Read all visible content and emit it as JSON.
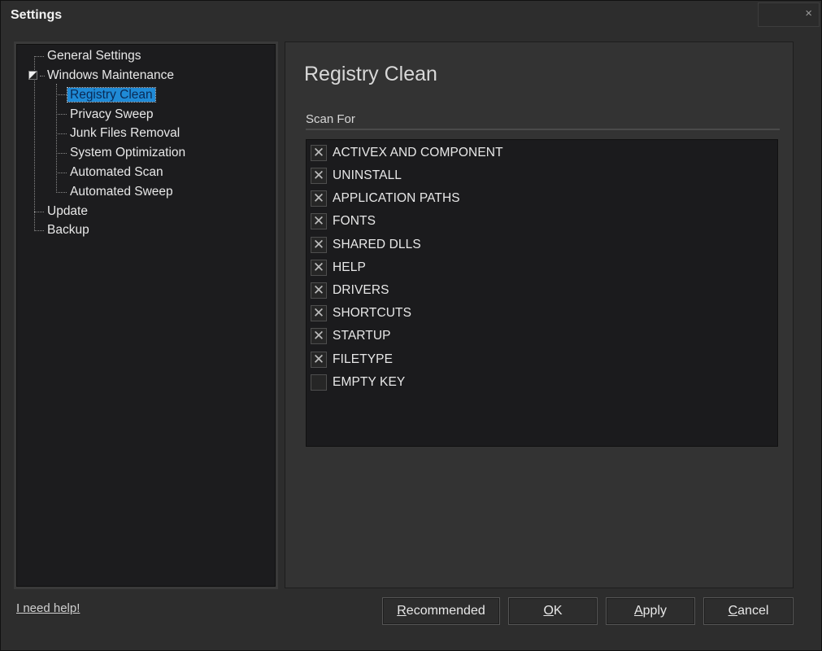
{
  "window": {
    "title": "Settings",
    "close_glyph": "×"
  },
  "tree": {
    "items": [
      {
        "label": "General Settings"
      },
      {
        "label": "Windows Maintenance"
      },
      {
        "label": "Registry Clean"
      },
      {
        "label": "Privacy Sweep"
      },
      {
        "label": "Junk Files Removal"
      },
      {
        "label": "System Optimization"
      },
      {
        "label": "Automated Scan"
      },
      {
        "label": "Automated Sweep"
      },
      {
        "label": "Update"
      },
      {
        "label": "Backup"
      }
    ],
    "selected": "Registry Clean"
  },
  "content": {
    "title": "Registry Clean",
    "scan_for_label": "Scan For",
    "options": [
      {
        "label": "ACTIVEX AND COMPONENT",
        "checked": true
      },
      {
        "label": "UNINSTALL",
        "checked": true
      },
      {
        "label": "APPLICATION PATHS",
        "checked": true
      },
      {
        "label": "FONTS",
        "checked": true
      },
      {
        "label": "SHARED DLLS",
        "checked": true
      },
      {
        "label": "HELP",
        "checked": true
      },
      {
        "label": "DRIVERS",
        "checked": true
      },
      {
        "label": "SHORTCUTS",
        "checked": true
      },
      {
        "label": "STARTUP",
        "checked": true
      },
      {
        "label": "FILETYPE",
        "checked": true
      },
      {
        "label": "EMPTY KEY",
        "checked": false
      }
    ],
    "check_glyph": "✕"
  },
  "footer": {
    "help_link": "I need help!",
    "buttons": {
      "recommended": {
        "first": "R",
        "rest": "ecommended"
      },
      "ok": {
        "first": "O",
        "rest": "K"
      },
      "apply": {
        "first": "A",
        "rest": "pply"
      },
      "cancel": {
        "first": "C",
        "rest": "ancel"
      }
    }
  },
  "colors": {
    "selection": "#1f8ad6",
    "panel": "#333333",
    "tree_bg": "#1c1c1e"
  }
}
